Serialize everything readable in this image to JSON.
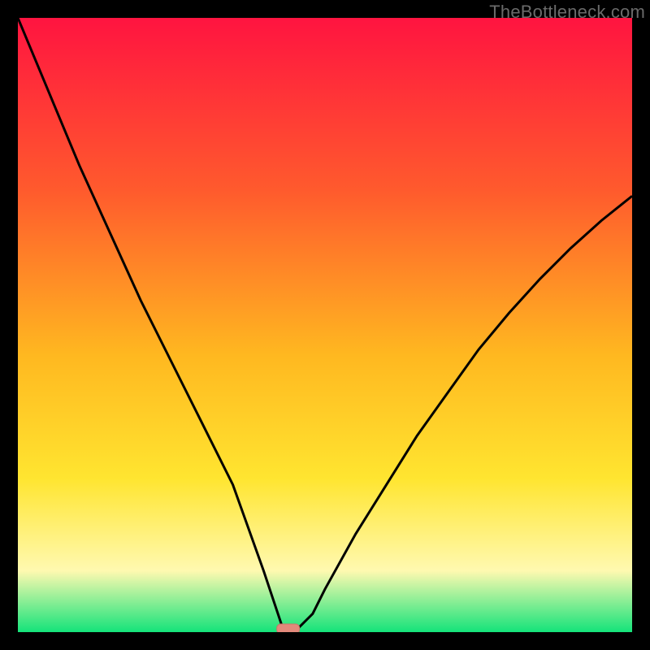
{
  "watermark": "TheBottleneck.com",
  "colors": {
    "frame": "#000000",
    "curve": "#000000",
    "marker_fill": "#e2897b",
    "marker_stroke": "#c9786a",
    "gradient": {
      "top": "#ff1440",
      "q1": "#ff5a2d",
      "mid": "#ffb820",
      "q3": "#ffe530",
      "low": "#fff9b0",
      "bottom": "#14e37a"
    }
  },
  "chart_data": {
    "type": "line",
    "title": "",
    "xlabel": "",
    "ylabel": "",
    "xlim": [
      0,
      100
    ],
    "ylim": [
      0,
      100
    ],
    "minimum_marker": {
      "x": 44,
      "y": 0
    },
    "series": [
      {
        "name": "curve",
        "x": [
          0,
          5,
          10,
          15,
          20,
          25,
          30,
          35,
          40,
          42,
          43,
          44,
          45,
          46,
          48,
          50,
          55,
          60,
          65,
          70,
          75,
          80,
          85,
          90,
          95,
          100
        ],
        "y": [
          100,
          88,
          76,
          65,
          54,
          44,
          34,
          24,
          10,
          4,
          1,
          0,
          0,
          1,
          3,
          7,
          16,
          24,
          32,
          39,
          46,
          52,
          57.5,
          62.5,
          67,
          71
        ]
      }
    ]
  }
}
